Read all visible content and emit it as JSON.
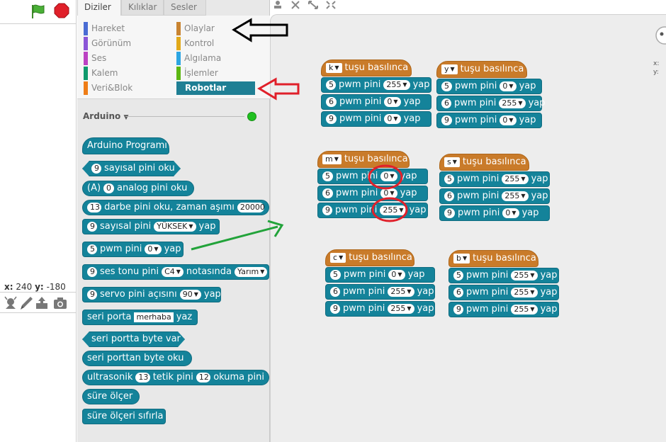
{
  "tabs": [
    "Diziler",
    "Kılıklar",
    "Sesler"
  ],
  "categories": {
    "left": [
      {
        "label": "Hareket",
        "color": "#4a6cd4"
      },
      {
        "label": "Görünüm",
        "color": "#8a55d7"
      },
      {
        "label": "Ses",
        "color": "#bb42c3"
      },
      {
        "label": "Kalem",
        "color": "#0e9a6c"
      },
      {
        "label": "Veri&Blok",
        "color": "#ee7d16"
      }
    ],
    "right": [
      {
        "label": "Olaylar",
        "color": "#c88330"
      },
      {
        "label": "Kontrol",
        "color": "#e1a91a"
      },
      {
        "label": "Algılama",
        "color": "#2ca5e2"
      },
      {
        "label": "İşlemler",
        "color": "#5cb712"
      },
      {
        "label": "Robotlar",
        "color": "#1f7f94"
      }
    ]
  },
  "palette": {
    "section_title": "Arduino",
    "status_color": "#20c020",
    "blocks": {
      "arduino_program": "Arduino Programı",
      "digital_read": {
        "pin": "9",
        "label": "sayısal pini oku"
      },
      "analog_read": {
        "prefix": "(A)",
        "pin": "0",
        "label": "analog pini oku"
      },
      "pulse_read": {
        "pin": "13",
        "label": "darbe pini oku, zaman aşımı",
        "timeout": "20000"
      },
      "digital_write": {
        "pin": "9",
        "label": "sayısal pini",
        "value": "YÜKSEK",
        "suffix": "yap"
      },
      "pwm_write": {
        "pin": "5",
        "label": "pwm pini",
        "value": "0",
        "suffix": "yap"
      },
      "tone": {
        "pin": "9",
        "label": "ses tonu pini",
        "note": "C4",
        "label2": "notasında",
        "beat": "Yarım"
      },
      "servo": {
        "pin": "9",
        "label": "servo pini açısını",
        "angle": "90",
        "suffix": "yap"
      },
      "serial_write": {
        "label": "seri porta",
        "text": "merhaba",
        "suffix": "yaz"
      },
      "serial_available": "seri portta byte var",
      "serial_read": "seri porttan byte oku",
      "ultrasonic": {
        "label": "ultrasonik",
        "trig": "13",
        "label2": "tetik pini",
        "echo": "12",
        "label3": "okuma pini"
      },
      "timer": "süre ölçer",
      "timer_reset": "süre ölçeri sıfırla"
    }
  },
  "stage": {
    "x_label": "x:",
    "x_value": "240",
    "y_label": "y:",
    "y_value": "-180"
  },
  "scripts": {
    "hat_suffix": "tuşu basılınca",
    "pwm_label": "pwm pini",
    "do_label": "yap",
    "groups": [
      {
        "key": "k",
        "rows": [
          {
            "pin": "5",
            "val": "255"
          },
          {
            "pin": "6",
            "val": "0"
          },
          {
            "pin": "9",
            "val": "0"
          }
        ]
      },
      {
        "key": "y",
        "rows": [
          {
            "pin": "5",
            "val": "0"
          },
          {
            "pin": "6",
            "val": "255"
          },
          {
            "pin": "9",
            "val": "0"
          }
        ]
      },
      {
        "key": "m",
        "rows": [
          {
            "pin": "5",
            "val": "0"
          },
          {
            "pin": "6",
            "val": "0"
          },
          {
            "pin": "9",
            "val": "255"
          }
        ]
      },
      {
        "key": "s",
        "rows": [
          {
            "pin": "5",
            "val": "255"
          },
          {
            "pin": "6",
            "val": "255"
          },
          {
            "pin": "9",
            "val": "0"
          }
        ]
      },
      {
        "key": "c",
        "rows": [
          {
            "pin": "5",
            "val": "0"
          },
          {
            "pin": "6",
            "val": "255"
          },
          {
            "pin": "9",
            "val": "255"
          }
        ]
      },
      {
        "key": "b",
        "rows": [
          {
            "pin": "5",
            "val": "255"
          },
          {
            "pin": "6",
            "val": "255"
          },
          {
            "pin": "9",
            "val": "255"
          }
        ]
      }
    ]
  },
  "colors": {
    "arrow_black": "#000000",
    "arrow_red": "#e0202a",
    "arrow_green": "#22a33a",
    "circle_red": "#e0202a"
  }
}
